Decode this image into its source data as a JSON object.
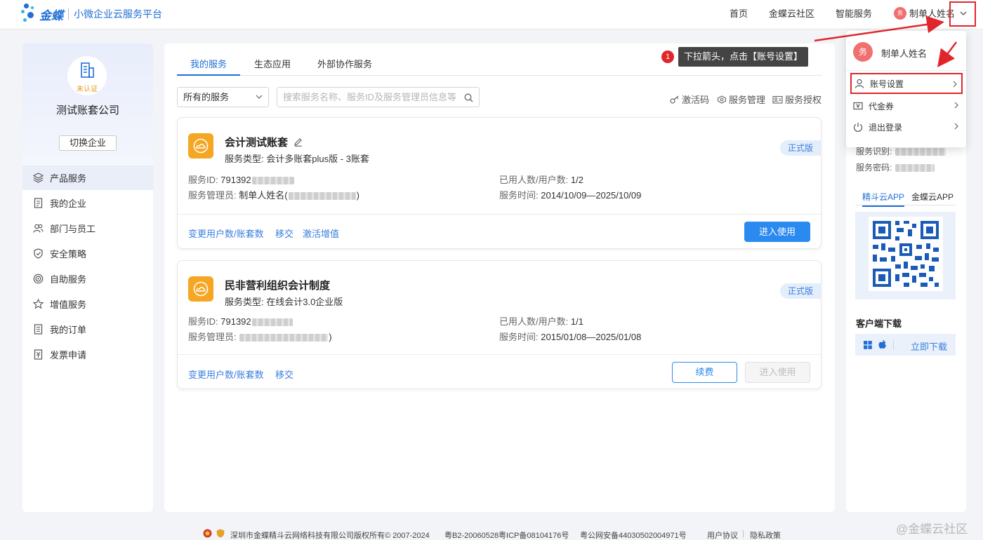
{
  "brand": {
    "logo": "金蝶",
    "subtitle": "小微企业云服务平台"
  },
  "topnav": {
    "home": "首页",
    "community": "金蝶云社区",
    "smart": "智能服务",
    "user_name": "制单人姓名",
    "avatar_char": "务"
  },
  "sidebar": {
    "cert_status": "未认证",
    "company": "测试账套公司",
    "switch_label": "切换企业",
    "items": [
      {
        "label": "产品服务",
        "icon": "layers-icon"
      },
      {
        "label": "我的企业",
        "icon": "document-icon"
      },
      {
        "label": "部门与员工",
        "icon": "people-icon"
      },
      {
        "label": "安全策略",
        "icon": "shield-icon"
      },
      {
        "label": "自助服务",
        "icon": "target-icon"
      },
      {
        "label": "增值服务",
        "icon": "star-icon"
      },
      {
        "label": "我的订单",
        "icon": "list-icon"
      },
      {
        "label": "发票申请",
        "icon": "invoice-icon"
      }
    ]
  },
  "main": {
    "tabs": [
      "我的服务",
      "生态应用",
      "外部协作服务"
    ],
    "filter_value": "所有的服务",
    "search_placeholder": "搜索服务名称、服务ID及服务管理员信息等",
    "tools": [
      "激活码",
      "服务管理",
      "服务授权"
    ],
    "cards": [
      {
        "title": "会计测试账套",
        "type_label": "服务类型: 会计多账套plus版 - 3账套",
        "badge": "正式版",
        "id_label": "服务ID:",
        "id_value": "791392",
        "admin_label": "服务管理员:",
        "admin_value": "制单人姓名(",
        "admin_tail": ")",
        "users_label": "已用人数/用户数:",
        "users_value": "1/2",
        "time_label": "服务时间:",
        "time_value": "2014/10/09—2025/10/09",
        "links": [
          "变更用户数/账套数",
          "移交",
          "激活增值"
        ],
        "enter_label": "进入使用"
      },
      {
        "title": "民非营利组织会计制度",
        "type_label": "服务类型: 在线会计3.0企业版",
        "badge": "正式版",
        "id_label": "服务ID:",
        "id_value": "791392",
        "admin_label": "服务管理员:",
        "admin_value": "",
        "admin_tail": ")",
        "users_label": "已用人数/用户数:",
        "users_value": "1/1",
        "time_label": "服务时间:",
        "time_value": "2015/01/08—2025/01/08",
        "links": [
          "变更用户数/账套数",
          "移交"
        ],
        "renew_label": "续费",
        "enter_label": "进入使用"
      }
    ]
  },
  "annotation": {
    "step": "1",
    "text": "下拉箭头，点击【账号设置】"
  },
  "dropdown": {
    "avatar_char": "务",
    "name": "制单人姓名",
    "items": [
      "账号设置",
      "代金券",
      "退出登录"
    ]
  },
  "right_panel": {
    "code_label": "服务识别:",
    "pwd_label": "服务密码:",
    "app_tabs": [
      "精斗云APP",
      "金蝶云APP"
    ],
    "download_title": "客户端下载",
    "download_link": "立即下载"
  },
  "footer": {
    "copyright": "深圳市金蝶精斗云网络科技有限公司版权所有© 2007-2024",
    "icp": "粤B2-20060528粤ICP备08104176号",
    "police": "粤公网安备44030502004971号",
    "agreement": "用户协议",
    "privacy": "隐私政策"
  },
  "watermark": "@金蝶云社区",
  "colors": {
    "accent": "#1f6fd6",
    "button": "#2a8af0",
    "annotation_red": "#e0262b",
    "product_orange": "#f5a623"
  }
}
